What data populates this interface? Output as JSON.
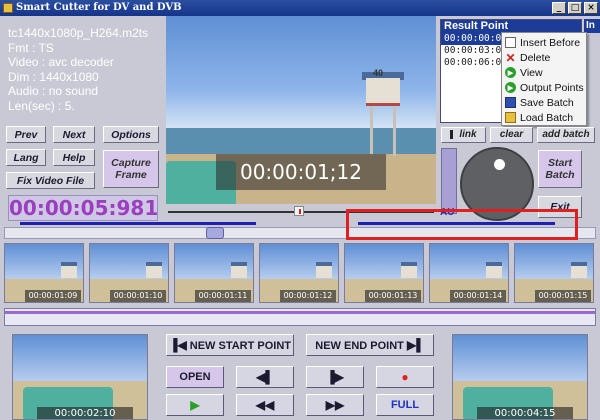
{
  "window": {
    "title": "Smart Cutter for DV and DVB",
    "controls": [
      "_",
      "□",
      "×"
    ]
  },
  "file_info": {
    "name": "tc1440x1080p_H264.m2ts",
    "fmt": "Fmt : TS",
    "video": "Video : avc decoder",
    "dim": "Dim : 1440x1080",
    "audio": "Audio : no sound",
    "len": "Len(sec) : 5."
  },
  "buttons": {
    "prev": "Prev",
    "next": "Next",
    "options": "Options",
    "lang": "Lang",
    "help": "Help",
    "capture_frame": "Capture Frame",
    "fix_video_file": "Fix Video File",
    "link": "link",
    "clear": "clear",
    "add_batch": "add batch",
    "start_batch": "Start Batch",
    "exit": "Exit"
  },
  "current_time": "00:00:05:981",
  "preview": {
    "overlay_timecode": "00:00:01;12",
    "tower_number": "40"
  },
  "result_point": {
    "header": "Result Point",
    "rows": [
      "00:00:00:000",
      "00:00:03:04",
      "00:00:06:08"
    ],
    "in_label": "In"
  },
  "context_menu": [
    {
      "label": "Insert Before",
      "icon": "insert-icon"
    },
    {
      "label": "Delete",
      "icon": "delete-icon"
    },
    {
      "label": "View",
      "icon": "view-icon"
    },
    {
      "label": "Output Points",
      "icon": "output-icon"
    },
    {
      "label": "Save Batch",
      "icon": "save-icon"
    },
    {
      "label": "Load Batch",
      "icon": "load-icon"
    }
  ],
  "au_label": "AU",
  "thumbnails": [
    "00:00:01:09",
    "00:00:01:10",
    "00:00:01:11",
    "00:00:01:12",
    "00:00:01:13",
    "00:00:01:14",
    "00:00:01:15"
  ],
  "bottom": {
    "left_preview_time": "00:00:02:10",
    "right_preview_time": "00:00:04:15",
    "new_start_point": "NEW START POINT",
    "new_end_point": "NEW END POINT",
    "open": "OPEN",
    "full": "FULL"
  },
  "colors": {
    "accent_blue": "#1d3c98",
    "timecode_purple": "#9b3fc0",
    "highlight_red": "#e02020"
  }
}
